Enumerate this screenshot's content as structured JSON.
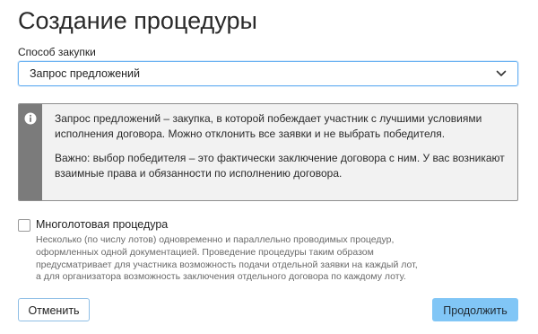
{
  "page": {
    "title": "Создание процедуры"
  },
  "procurement_method": {
    "label": "Способ закупки",
    "selected_value": "Запрос предложений"
  },
  "info": {
    "paragraph1": "Запрос предложений – закупка, в которой побеждает участник с лучшими условиями исполнения договора. Можно отклонить все заявки и не выбрать победителя.",
    "paragraph2": "Важно: выбор победителя – это фактически заключение договора с ним. У вас возникают взаимные права и обязанности по исполнению договора."
  },
  "multilot": {
    "label": "Многолотовая процедура",
    "checked": false,
    "description": "Несколько (по числу лотов) одновременно и параллельно проводимых процедур, оформленных одной документацией. Проведение процедуры таким образом предусматривает для участника возможность подачи отдельной заявки на каждый лот, а для организатора возможность заключения отдельного договора по каждому лоту."
  },
  "actions": {
    "cancel_label": "Отменить",
    "continue_label": "Продолжить"
  },
  "colors": {
    "select_border": "#6fb4f2",
    "info_stripe": "#7b7b7b",
    "info_background": "#f2f2f2",
    "primary_button": "#81c6f6",
    "secondary_button_border": "#8fbfe6"
  },
  "icons": {
    "select_arrow": "chevron-down-icon",
    "info": "info-icon"
  }
}
